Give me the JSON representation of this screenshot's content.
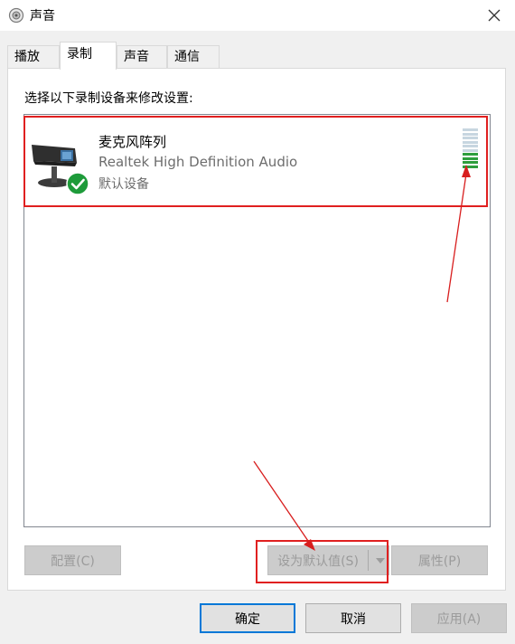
{
  "window": {
    "title": "声音",
    "icon": "speaker-icon",
    "close_icon": "close-icon"
  },
  "tabs": [
    {
      "label": "播放",
      "active": false
    },
    {
      "label": "录制",
      "active": true
    },
    {
      "label": "声音",
      "active": false
    },
    {
      "label": "通信",
      "active": false
    }
  ],
  "recording": {
    "instruction": "选择以下录制设备来修改设置:",
    "devices": [
      {
        "name": "麦克风阵列",
        "driver": "Realtek High Definition Audio",
        "status": "默认设备",
        "icon": "microphone-array-icon",
        "status_icon": "green-checkmark-icon",
        "level_meter": {
          "segments": 10,
          "lit_segments": 4
        }
      }
    ]
  },
  "panel_buttons": {
    "configure": "配置(C)",
    "set_default": "设为默认值(S)",
    "properties": "属性(P)"
  },
  "dialog_buttons": {
    "ok": "确定",
    "cancel": "取消",
    "apply": "应用(A)"
  },
  "colors": {
    "annotation_red": "#e02020",
    "meter_active": "#2e9e3d",
    "meter_inactive": "#c7d6e0",
    "focus_blue": "#0078d7"
  }
}
